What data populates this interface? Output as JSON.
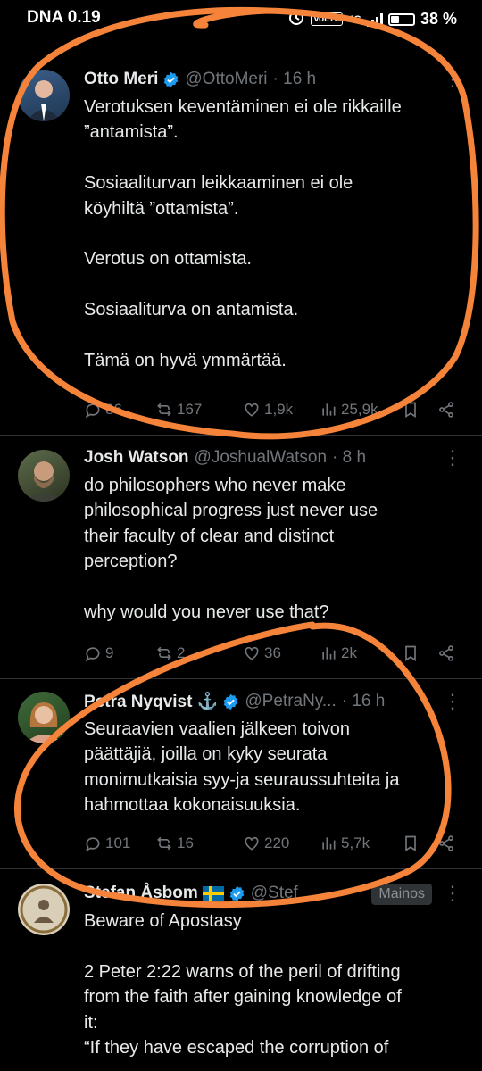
{
  "status_bar": {
    "carrier": "DNA 0.19",
    "network": "4G",
    "volte": "VoLTE",
    "battery": "38 %",
    "battery_level": 0.38
  },
  "colors": {
    "accent": "#1d9bf0",
    "scribble": "#f5843a"
  },
  "tweets": [
    {
      "name": "Otto Meri",
      "handle": "@OttoMeri",
      "time": "· 16 h",
      "verified": true,
      "text": "Verotuksen keventäminen ei ole rikkaille\n”antamista”.\n\nSosiaaliturvan leikkaaminen ei ole\nköyhiltä ”ottamista”.\n\nVerotus on ottamista.\n\nSosiaaliturva on antamista.\n\nTämä on hyvä ymmärtää.",
      "replies": "86",
      "reposts": "167",
      "likes": "1,9k",
      "views": "25,9k"
    },
    {
      "name": "Josh Watson",
      "handle": "@JoshualWatson",
      "time": "· 8 h",
      "verified": false,
      "text": "do philosophers who never make\nphilosophical progress just never use\ntheir faculty of clear and distinct\nperception?\n\nwhy would you never use that?",
      "replies": "9",
      "reposts": "2",
      "likes": "36",
      "views": "2k"
    },
    {
      "name": "Petra Nyqvist ⚓",
      "handle": "@PetraNy...",
      "time": "· 16 h",
      "verified": true,
      "text": "Seuraavien vaalien jälkeen toivon\npäättäjiä, joilla on kyky seurata\nmonimutkaisia syy-ja seuraussuhteita ja\nhahmottaa kokonaisuuksia.",
      "replies": "101",
      "reposts": "16",
      "likes": "220",
      "views": "5,7k"
    },
    {
      "name": "Stefan Åsbom",
      "handle": "@Stef",
      "verified": true,
      "ad_label": "Mainos",
      "text": "Beware of Apostasy\n\n2 Peter 2:22 warns of the peril of drifting\nfrom the faith after gaining knowledge of\nit:\n“If they have escaped the corruption of"
    }
  ]
}
